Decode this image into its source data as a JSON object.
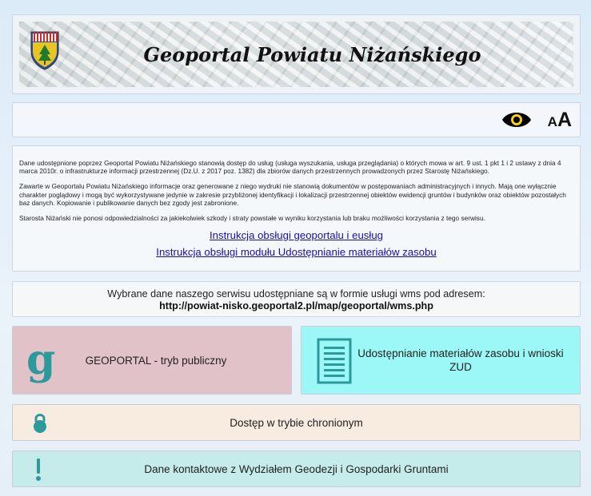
{
  "header": {
    "title": "Geoportal Powiatu Niżańskiego",
    "logo_icon": "coat-of-arms-icon"
  },
  "toolbar": {
    "contrast_icon": "eye-icon",
    "font_small": "A",
    "font_big": "A"
  },
  "info": {
    "paragraph1": "Dane udostępnione poprzez Geoportal Powiatu Niżańskiego stanowią dostęp do usług (usługa wyszukania, usługa przeglądania) o których mowa w art. 9 ust. 1 pkt 1 i 2 ustawy z dnia 4 marca 2010r. o infrastrukturze informacji przestrzennej (Dz.U. z 2017 poz. 1382) dla zbiorów danych przestrzennych prowadzonych przez Starostę Niżańskiego.",
    "paragraph2": "Zawarte w Geoportalu Powiatu Niżańskiego informacje oraz generowane z niego wydruki nie stanowią dokumentów w postępowaniach administracyjnych i innych. Mają one wyłącznie charakter poglądowy i mogą być wykorzystywane jedynie w zakresie przybliżonej identyfikacji i lokalizacji przestrzennej obiektów ewidencji gruntów i budynków oraz obiektów pozostałych baz danych. Kopiowanie i publikowanie danych bez zgody jest zabronione.",
    "paragraph3": "Starosta Niżański nie ponosi odpowiedzialności za jakiekolwiek szkody i straty powstałe w wyniku korzystania lub braku możliwości korzystania z tego serwisu.",
    "link1": "Instrukcja obsługi geoportalu i eusług",
    "link2": "Instrukcja obsługi modułu Udostępnianie materiałów zasobu"
  },
  "wms": {
    "line1": "Wybrane dane naszego serwisu udostępniane są w formie usługi wms pod adresem:",
    "url": "http://powiat-nisko.geoportal2.pl/map/geoportal/wms.php"
  },
  "tiles": {
    "geoportal": {
      "label": "GEOPORTAL - tryb publiczny",
      "icon": "g",
      "color": "#e0c2c8"
    },
    "zud": {
      "label": "Udostępnianie materiałów zasobu i wnioski ZUD",
      "icon": "document-icon",
      "color": "#9cf7f7"
    },
    "secure": {
      "label": "Dostęp w trybie chronionym",
      "icon": "lock-icon",
      "color": "#f8ebe0"
    },
    "contact": {
      "label": "Dane kontaktowe z Wydziałem Geodezji i Gospodarki Gruntami",
      "icon": "exclamation-icon",
      "color": "#c5ebea"
    }
  },
  "accent_color": "#2c9a9a"
}
